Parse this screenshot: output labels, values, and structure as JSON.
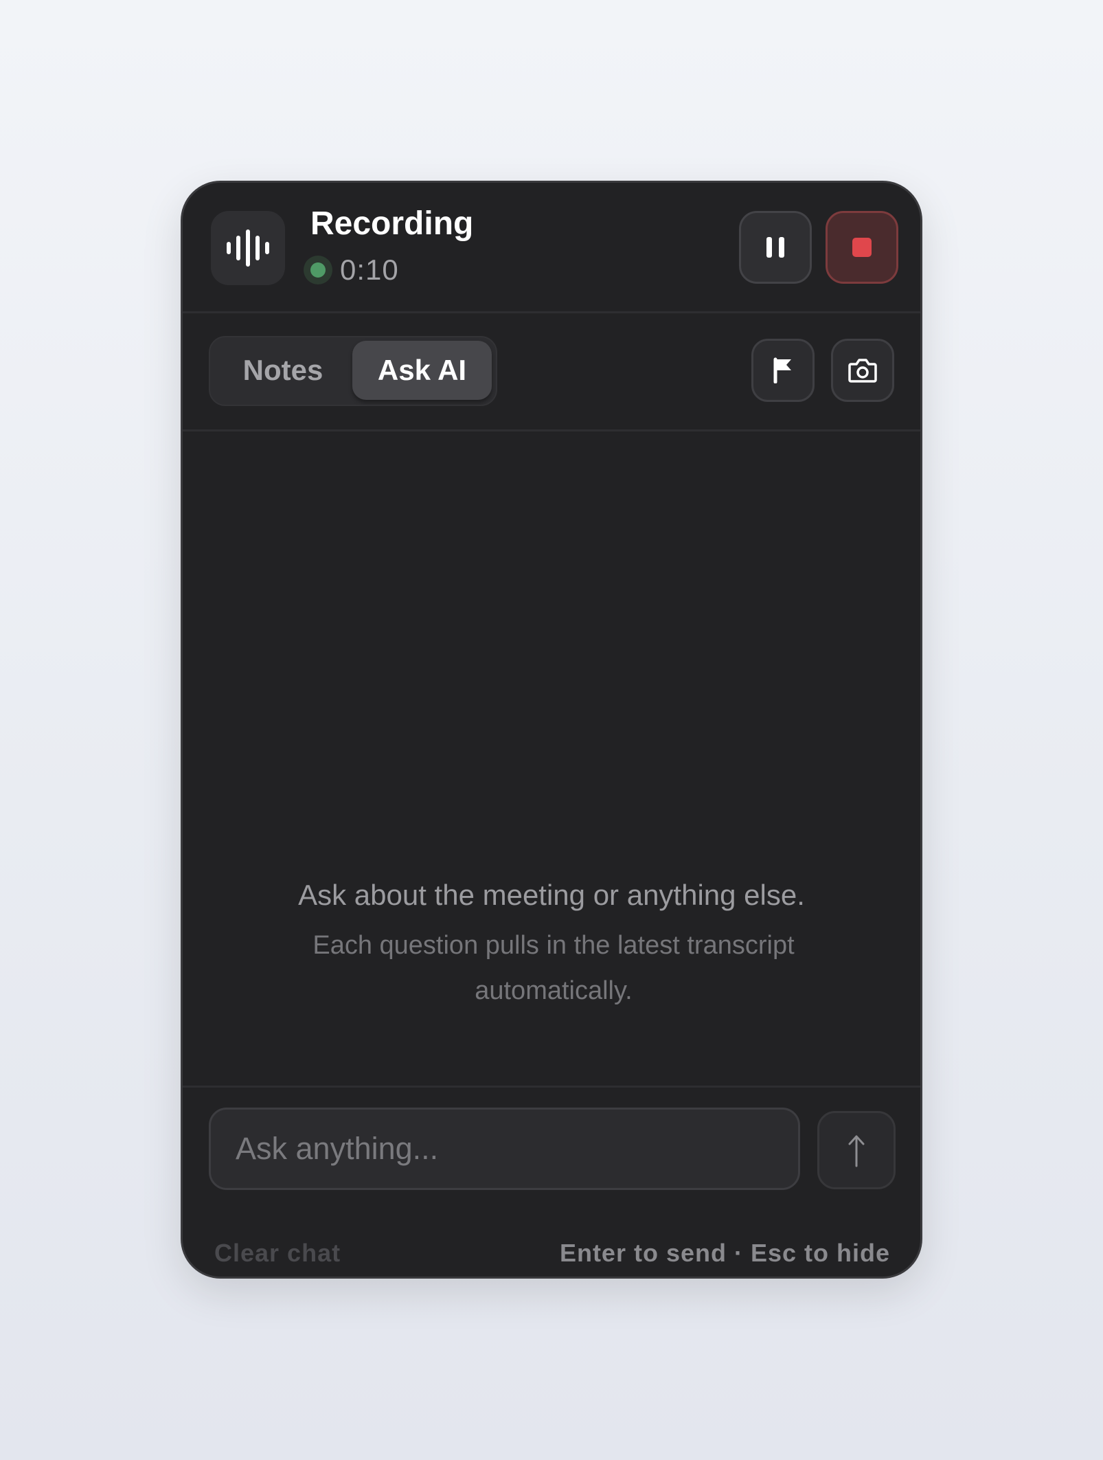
{
  "header": {
    "title": "Recording",
    "timer": "0:10",
    "status_color": "#4f9a66",
    "icons": {
      "app": "waveform-icon",
      "pause": "pause-icon",
      "stop": "stop-icon"
    },
    "stop_accent": "#e0474c"
  },
  "toolbar": {
    "tabs": [
      {
        "label": "Notes",
        "selected": false
      },
      {
        "label": "Ask AI",
        "selected": true
      }
    ],
    "icons": {
      "bookmark": "flag-icon",
      "screenshot": "camera-icon"
    }
  },
  "empty_state": {
    "title": "Ask about the meeting or anything else.",
    "subtitle": "Each question pulls in the latest transcript automatically."
  },
  "composer": {
    "input_placeholder": "Ask anything...",
    "input_value": "",
    "send_icon": "arrow-up-icon",
    "clear_label": "Clear chat",
    "hint": "Enter to send · Esc to hide"
  }
}
